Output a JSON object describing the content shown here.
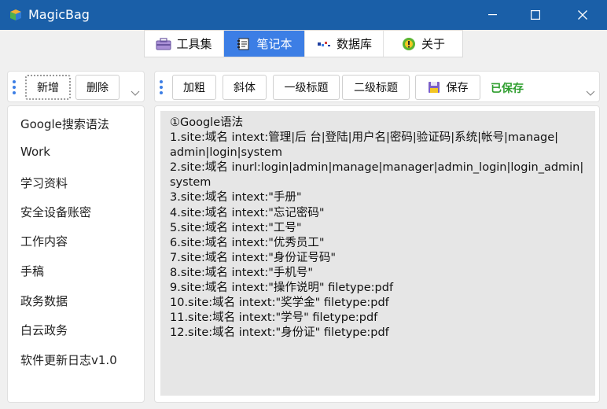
{
  "window": {
    "title": "MagicBag"
  },
  "tabs": [
    {
      "label": "工具集",
      "icon": "toolbox-icon",
      "active": false
    },
    {
      "label": "笔记本",
      "icon": "notebook-icon",
      "active": true
    },
    {
      "label": "数据库",
      "icon": "database-icon",
      "active": false
    },
    {
      "label": "关于",
      "icon": "info-icon",
      "active": false
    }
  ],
  "left_toolbar": {
    "add_label": "新增",
    "delete_label": "删除"
  },
  "notes_list": [
    "Google搜索语法",
    "Work",
    "学习资料",
    "安全设备账密",
    "工作内容",
    "手稿",
    "政务数据",
    "白云政务",
    "软件更新日志v1.0"
  ],
  "editor_toolbar": {
    "bold_label": "加粗",
    "italic_label": "斜体",
    "h1_label": "一级标题",
    "h2_label": "二级标题",
    "save_label": "保存",
    "saved_status": "已保存"
  },
  "editor_lines": [
    "①Google语法",
    "1.site:域名 intext:管理|后 台|登陆|用户名|密码|验证码|系统|帐号|manage|",
    "admin|login|system",
    "2.site:域名 inurl:login|admin|manage|manager|admin_login|login_admin|",
    "system",
    "3.site:域名 intext:\"手册\"",
    "4.site:域名 intext:\"忘记密码\"",
    "5.site:域名 intext:\"工号\"",
    "6.site:域名 intext:\"优秀员工\"",
    "7.site:域名 intext:\"身份证号码\"",
    "8.site:域名 intext:\"手机号\"",
    "9.site:域名 intext:\"操作说明\" filetype:pdf",
    "10.site:域名 intext:\"奖学金\" filetype:pdf",
    "11.site:域名 intext:\"学号\" filetype:pdf",
    "12.site:域名 intext:\"身份证\" filetype:pdf"
  ],
  "colors": {
    "titlebar": "#1a5fa8",
    "active_tab": "#3c7ee5",
    "saved_text": "#2f9e2f",
    "editor_bg": "#e6e6e6"
  }
}
